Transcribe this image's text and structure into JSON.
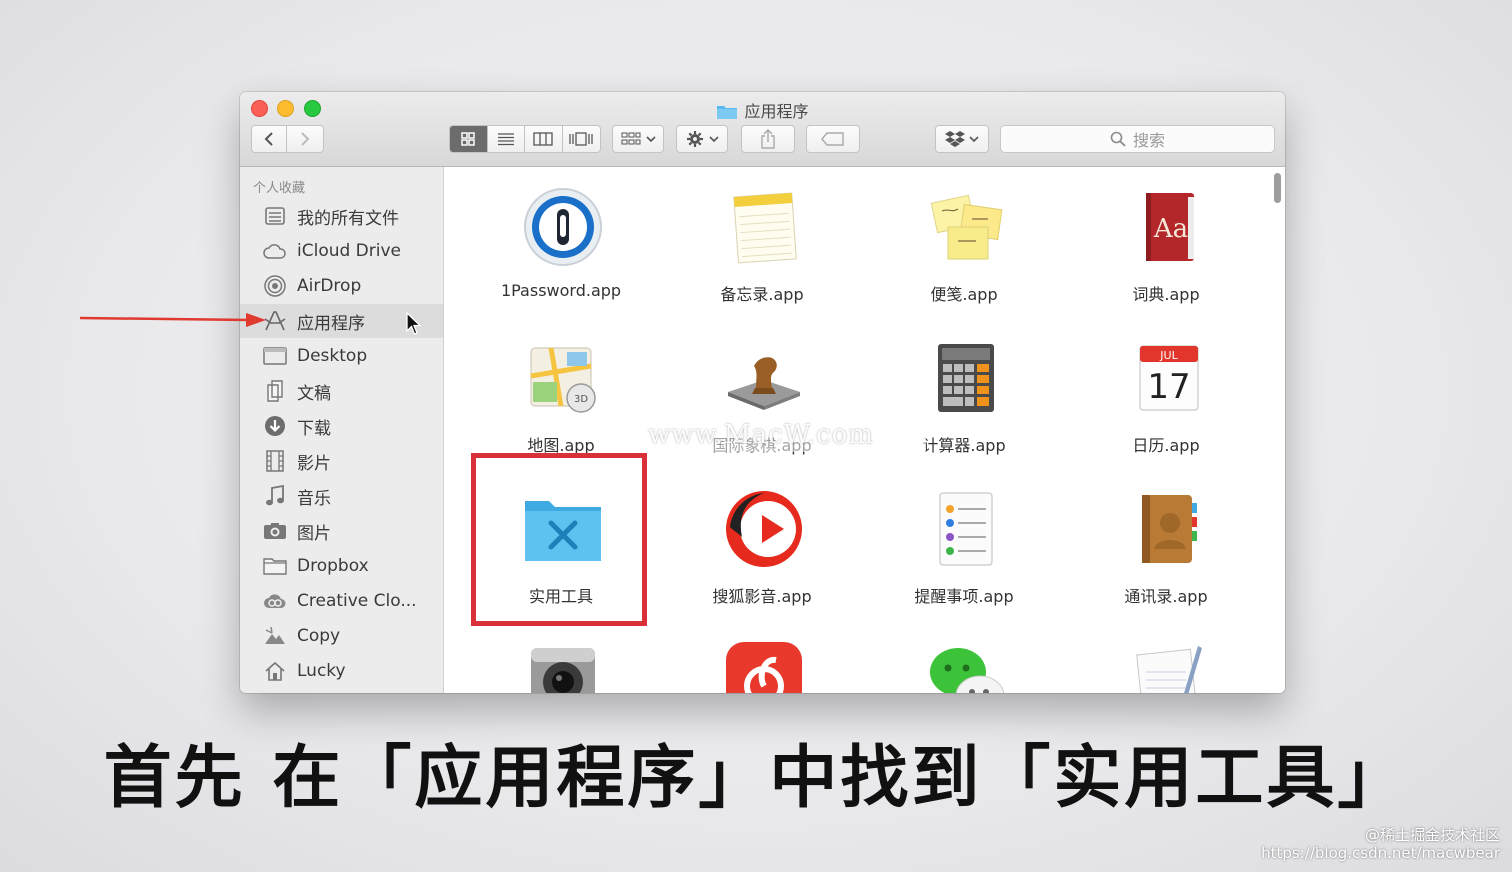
{
  "window": {
    "title": "应用程序",
    "search_placeholder": "搜索"
  },
  "sidebar": {
    "section_label": "个人收藏",
    "items": [
      {
        "label": "我的所有文件",
        "icon": "all-files-icon"
      },
      {
        "label": "iCloud Drive",
        "icon": "cloud-icon"
      },
      {
        "label": "AirDrop",
        "icon": "airdrop-icon"
      },
      {
        "label": "应用程序",
        "icon": "applications-icon",
        "selected": true
      },
      {
        "label": "Desktop",
        "icon": "desktop-icon"
      },
      {
        "label": "文稿",
        "icon": "documents-icon"
      },
      {
        "label": "下载",
        "icon": "download-icon"
      },
      {
        "label": "影片",
        "icon": "movies-icon"
      },
      {
        "label": "音乐",
        "icon": "music-icon"
      },
      {
        "label": "图片",
        "icon": "pictures-icon"
      },
      {
        "label": "Dropbox",
        "icon": "folder-icon"
      },
      {
        "label": "Creative Clo...",
        "icon": "creative-cloud-icon"
      },
      {
        "label": "Copy",
        "icon": "copy-icon"
      },
      {
        "label": "Lucky",
        "icon": "home-icon"
      }
    ]
  },
  "apps": [
    {
      "label": "1Password.app",
      "icon": "1password-icon"
    },
    {
      "label": "备忘录.app",
      "icon": "notes-icon"
    },
    {
      "label": "便笺.app",
      "icon": "stickies-icon"
    },
    {
      "label": "词典.app",
      "icon": "dictionary-icon"
    },
    {
      "label": "地图.app",
      "icon": "maps-icon"
    },
    {
      "label": "国际象棋.app",
      "icon": "chess-icon"
    },
    {
      "label": "计算器.app",
      "icon": "calculator-icon"
    },
    {
      "label": "日历.app",
      "icon": "calendar-icon"
    },
    {
      "label": "实用工具",
      "icon": "utilities-folder-icon"
    },
    {
      "label": "搜狐影音.app",
      "icon": "sohu-video-icon"
    },
    {
      "label": "提醒事项.app",
      "icon": "reminders-icon"
    },
    {
      "label": "通讯录.app",
      "icon": "contacts-icon"
    },
    {
      "label": "",
      "icon": "image-capture-icon"
    },
    {
      "label": "",
      "icon": "netease-music-icon"
    },
    {
      "label": "",
      "icon": "wechat-icon"
    },
    {
      "label": "",
      "icon": "textedit-icon"
    }
  ],
  "calendar_icon": {
    "month": "JUL",
    "day": "17"
  },
  "dictionary_icon": {
    "text": "Aa"
  },
  "watermark": "www.MacW.com",
  "caption": "首先 在「应用程序」中找到「实用工具」",
  "credit": {
    "line1": "@稀土掘金技术社区",
    "line2": "https://blog.csdn.net/macwbear"
  },
  "colors": {
    "highlight": "#d9303a",
    "folder_blue": "#4fb3ea",
    "selection": "#dcdcdc"
  }
}
